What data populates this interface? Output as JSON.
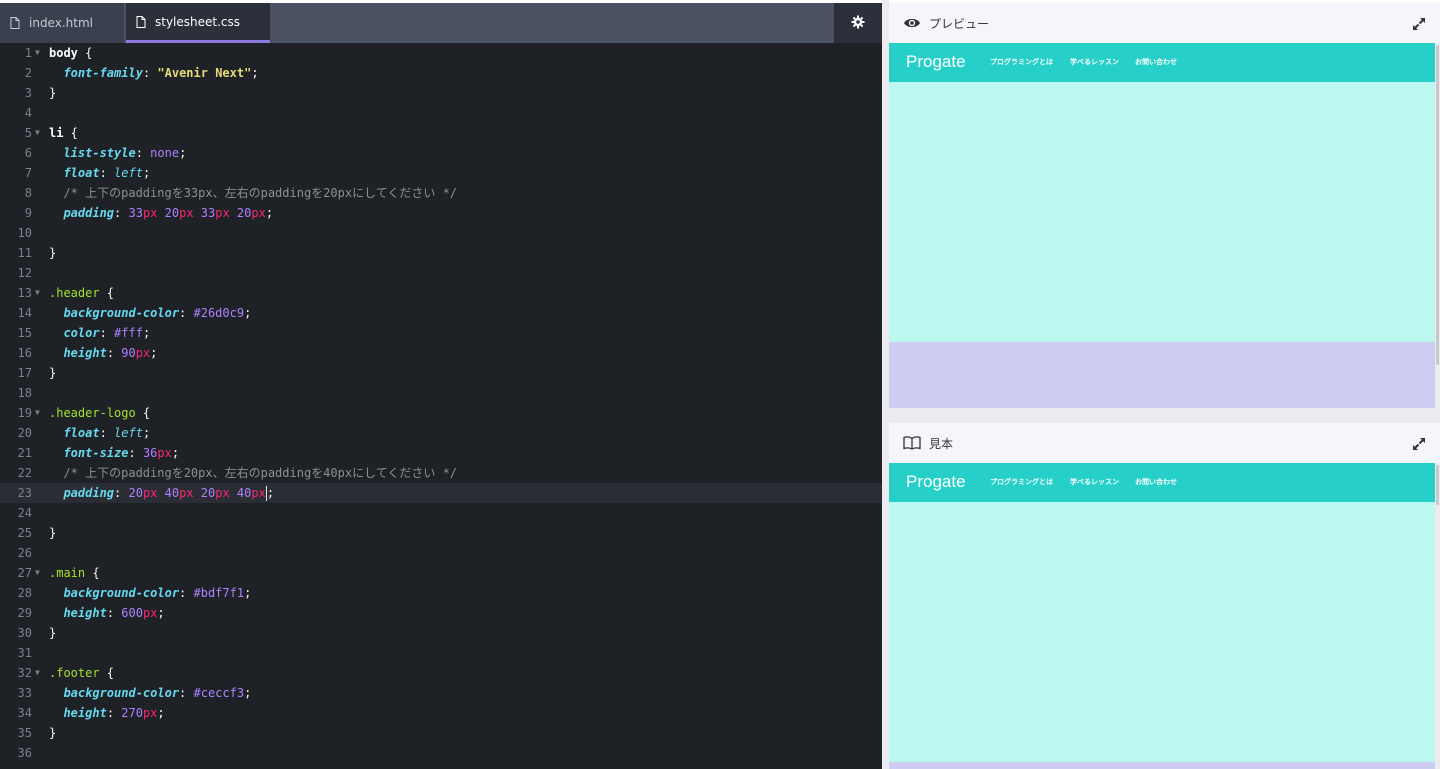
{
  "editor": {
    "tabs": [
      {
        "label": "index.html",
        "icon": "file-icon"
      },
      {
        "label": "stylesheet.css",
        "icon": "file-icon"
      }
    ],
    "settings_icon": "gear-icon",
    "lines": [
      {
        "n": "1",
        "fold": true,
        "tokens": [
          [
            "sel",
            "body"
          ],
          [
            "punc",
            " {"
          ]
        ]
      },
      {
        "n": "2",
        "tokens": [
          [
            "punc",
            "  "
          ],
          [
            "prop",
            "font-family"
          ],
          [
            "punc",
            ": "
          ],
          [
            "str",
            "\"Avenir Next\""
          ],
          [
            "punc",
            ";"
          ]
        ]
      },
      {
        "n": "3",
        "tokens": [
          [
            "punc",
            "}"
          ]
        ]
      },
      {
        "n": "4",
        "tokens": []
      },
      {
        "n": "5",
        "fold": true,
        "tokens": [
          [
            "sel",
            "li"
          ],
          [
            "punc",
            " {"
          ]
        ]
      },
      {
        "n": "6",
        "tokens": [
          [
            "punc",
            "  "
          ],
          [
            "prop",
            "list-style"
          ],
          [
            "punc",
            ": "
          ],
          [
            "num",
            "none"
          ],
          [
            "punc",
            ";"
          ]
        ]
      },
      {
        "n": "7",
        "tokens": [
          [
            "punc",
            "  "
          ],
          [
            "prop",
            "float"
          ],
          [
            "punc",
            ": "
          ],
          [
            "kw",
            "left"
          ],
          [
            "punc",
            ";"
          ]
        ]
      },
      {
        "n": "8",
        "tokens": [
          [
            "punc",
            "  "
          ],
          [
            "cmt",
            "/* 上下のpaddingを33px、左右のpaddingを20pxにしてください */"
          ]
        ]
      },
      {
        "n": "9",
        "tokens": [
          [
            "punc",
            "  "
          ],
          [
            "prop",
            "padding"
          ],
          [
            "punc",
            ": "
          ],
          [
            "num",
            "33"
          ],
          [
            "unit",
            "px"
          ],
          [
            "punc",
            " "
          ],
          [
            "num",
            "20"
          ],
          [
            "unit",
            "px"
          ],
          [
            "punc",
            " "
          ],
          [
            "num",
            "33"
          ],
          [
            "unit",
            "px"
          ],
          [
            "punc",
            " "
          ],
          [
            "num",
            "20"
          ],
          [
            "unit",
            "px"
          ],
          [
            "punc",
            ";"
          ]
        ]
      },
      {
        "n": "10",
        "tokens": []
      },
      {
        "n": "11",
        "tokens": [
          [
            "punc",
            "}"
          ]
        ]
      },
      {
        "n": "12",
        "tokens": []
      },
      {
        "n": "13",
        "fold": true,
        "tokens": [
          [
            "cls",
            ".header"
          ],
          [
            "punc",
            " {"
          ]
        ]
      },
      {
        "n": "14",
        "tokens": [
          [
            "punc",
            "  "
          ],
          [
            "prop",
            "background-color"
          ],
          [
            "punc",
            ": "
          ],
          [
            "num",
            "#26d0c9"
          ],
          [
            "punc",
            ";"
          ]
        ]
      },
      {
        "n": "15",
        "tokens": [
          [
            "punc",
            "  "
          ],
          [
            "prop",
            "color"
          ],
          [
            "punc",
            ": "
          ],
          [
            "num",
            "#fff"
          ],
          [
            "punc",
            ";"
          ]
        ]
      },
      {
        "n": "16",
        "tokens": [
          [
            "punc",
            "  "
          ],
          [
            "prop",
            "height"
          ],
          [
            "punc",
            ": "
          ],
          [
            "num",
            "90"
          ],
          [
            "unit",
            "px"
          ],
          [
            "punc",
            ";"
          ]
        ]
      },
      {
        "n": "17",
        "tokens": [
          [
            "punc",
            "}"
          ]
        ]
      },
      {
        "n": "18",
        "tokens": []
      },
      {
        "n": "19",
        "fold": true,
        "tokens": [
          [
            "cls",
            ".header-logo"
          ],
          [
            "punc",
            " {"
          ]
        ]
      },
      {
        "n": "20",
        "tokens": [
          [
            "punc",
            "  "
          ],
          [
            "prop",
            "float"
          ],
          [
            "punc",
            ": "
          ],
          [
            "kw",
            "left"
          ],
          [
            "punc",
            ";"
          ]
        ]
      },
      {
        "n": "21",
        "tokens": [
          [
            "punc",
            "  "
          ],
          [
            "prop",
            "font-size"
          ],
          [
            "punc",
            ": "
          ],
          [
            "num",
            "36"
          ],
          [
            "unit",
            "px"
          ],
          [
            "punc",
            ";"
          ]
        ]
      },
      {
        "n": "22",
        "tokens": [
          [
            "punc",
            "  "
          ],
          [
            "cmt",
            "/* 上下のpaddingを20px、左右のpaddingを40pxにしてください */"
          ]
        ]
      },
      {
        "n": "23",
        "active": true,
        "tokens": [
          [
            "punc",
            "  "
          ],
          [
            "prop",
            "padding"
          ],
          [
            "punc",
            ": "
          ],
          [
            "num",
            "20"
          ],
          [
            "unit",
            "px"
          ],
          [
            "punc",
            " "
          ],
          [
            "num",
            "40"
          ],
          [
            "unit",
            "px"
          ],
          [
            "punc",
            " "
          ],
          [
            "num",
            "20"
          ],
          [
            "unit",
            "px"
          ],
          [
            "punc",
            " "
          ],
          [
            "num",
            "40"
          ],
          [
            "unit",
            "px"
          ],
          [
            "cursor",
            ""
          ],
          [
            "punc",
            ";"
          ]
        ]
      },
      {
        "n": "24",
        "tokens": []
      },
      {
        "n": "25",
        "tokens": [
          [
            "punc",
            "}"
          ]
        ]
      },
      {
        "n": "26",
        "tokens": []
      },
      {
        "n": "27",
        "fold": true,
        "tokens": [
          [
            "cls",
            ".main"
          ],
          [
            "punc",
            " {"
          ]
        ]
      },
      {
        "n": "28",
        "tokens": [
          [
            "punc",
            "  "
          ],
          [
            "prop",
            "background-color"
          ],
          [
            "punc",
            ": "
          ],
          [
            "num",
            "#bdf7f1"
          ],
          [
            "punc",
            ";"
          ]
        ]
      },
      {
        "n": "29",
        "tokens": [
          [
            "punc",
            "  "
          ],
          [
            "prop",
            "height"
          ],
          [
            "punc",
            ": "
          ],
          [
            "num",
            "600"
          ],
          [
            "unit",
            "px"
          ],
          [
            "punc",
            ";"
          ]
        ]
      },
      {
        "n": "30",
        "tokens": [
          [
            "punc",
            "}"
          ]
        ]
      },
      {
        "n": "31",
        "tokens": []
      },
      {
        "n": "32",
        "fold": true,
        "tokens": [
          [
            "cls",
            ".footer"
          ],
          [
            "punc",
            " {"
          ]
        ]
      },
      {
        "n": "33",
        "tokens": [
          [
            "punc",
            "  "
          ],
          [
            "prop",
            "background-color"
          ],
          [
            "punc",
            ": "
          ],
          [
            "num",
            "#ceccf3"
          ],
          [
            "punc",
            ";"
          ]
        ]
      },
      {
        "n": "34",
        "tokens": [
          [
            "punc",
            "  "
          ],
          [
            "prop",
            "height"
          ],
          [
            "punc",
            ": "
          ],
          [
            "num",
            "270"
          ],
          [
            "unit",
            "px"
          ],
          [
            "punc",
            ";"
          ]
        ]
      },
      {
        "n": "35",
        "tokens": [
          [
            "punc",
            "}"
          ]
        ]
      },
      {
        "n": "36",
        "tokens": []
      }
    ]
  },
  "preview": {
    "title": "プレビュー",
    "icon": "eye-icon",
    "expand_icon": "expand-icon",
    "site": {
      "logo": "Progate",
      "nav": [
        "プログラミングとは",
        "学べるレッスン",
        "お問い合わせ"
      ]
    }
  },
  "sample": {
    "title": "見本",
    "icon": "book-icon",
    "expand_icon": "expand-icon",
    "site": {
      "logo": "Progate",
      "nav": [
        "プログラミングとは",
        "学べるレッスン",
        "お問い合わせ"
      ]
    }
  },
  "colors": {
    "header": "#26d0c9",
    "main": "#bdf7f1",
    "footer": "#ceccf3",
    "editor_bg": "#1e2126",
    "tab_active_underline": "#8c7ae0"
  }
}
